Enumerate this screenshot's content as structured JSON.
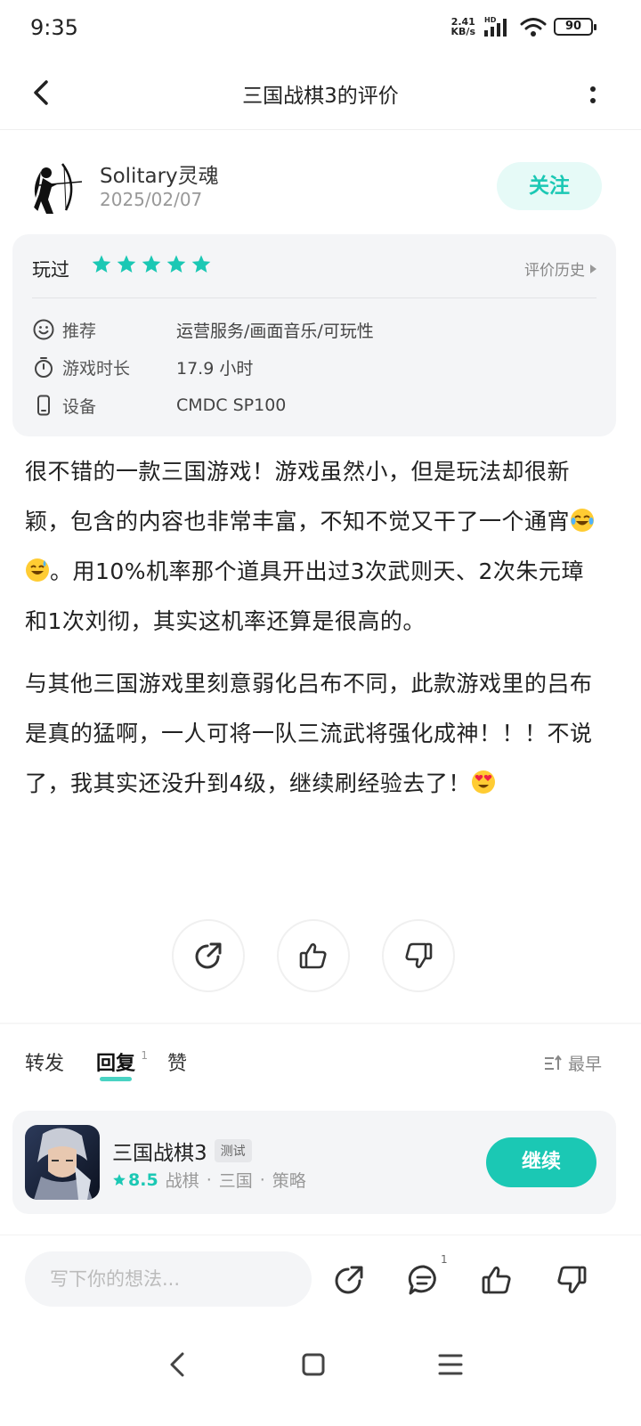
{
  "status_bar": {
    "time": "9:35",
    "net_speed_value": "2.41",
    "net_speed_unit": "KB/s",
    "hd": "HD",
    "battery": "90"
  },
  "header": {
    "title": "三国战棋3的评价"
  },
  "author": {
    "name": "Solitary灵魂",
    "date": "2025/02/07",
    "follow_label": "关注"
  },
  "review": {
    "status_label": "玩过",
    "rating": 5,
    "history_label": "评价历史",
    "info": [
      {
        "icon": "smile-icon",
        "label": "推荐",
        "value": "运营服务/画面音乐/可玩性"
      },
      {
        "icon": "stopwatch-icon",
        "label": "游戏时长",
        "value": "17.9 小时"
      },
      {
        "icon": "phone-icon",
        "label": "设备",
        "value": "CMDC SP100"
      }
    ],
    "paragraph1_a": "很不错的一款三国游戏！游戏虽然小，但是玩法却很新颖，包含的内容也非常丰富，不知不觉又干了一个通宵",
    "paragraph1_b": "。用10%机率那个道具开出过3次武则天、2次朱元璋和1次刘彻，其实这机率还算是很高的。",
    "paragraph2_a": "与其他三国游戏里刻意弱化吕布不同，此款游戏里的吕布是真的猛啊，一人可将一队三流武将强化成神！！！不说了，我其实还没升到4级，继续刷经验去了！",
    "emojis": [
      "face-with-tears-of-joy",
      "grinning-sweat",
      "heart-eyes"
    ]
  },
  "tabs": [
    {
      "label": "转发"
    },
    {
      "label": "回复",
      "count": "1"
    },
    {
      "label": "赞"
    }
  ],
  "sort_label": "最早",
  "game": {
    "name": "三国战棋3",
    "badge": "测试",
    "score": "8.5",
    "tags": [
      "战棋",
      "三国",
      "策略"
    ],
    "tag_separator": "·",
    "action_label": "继续"
  },
  "input_bar": {
    "placeholder": "写下你的想法...",
    "comment_count": "1"
  },
  "colors": {
    "accent": "#1bc8b4",
    "accent_light": "#e6faf7",
    "card_bg": "#f4f5f7"
  }
}
